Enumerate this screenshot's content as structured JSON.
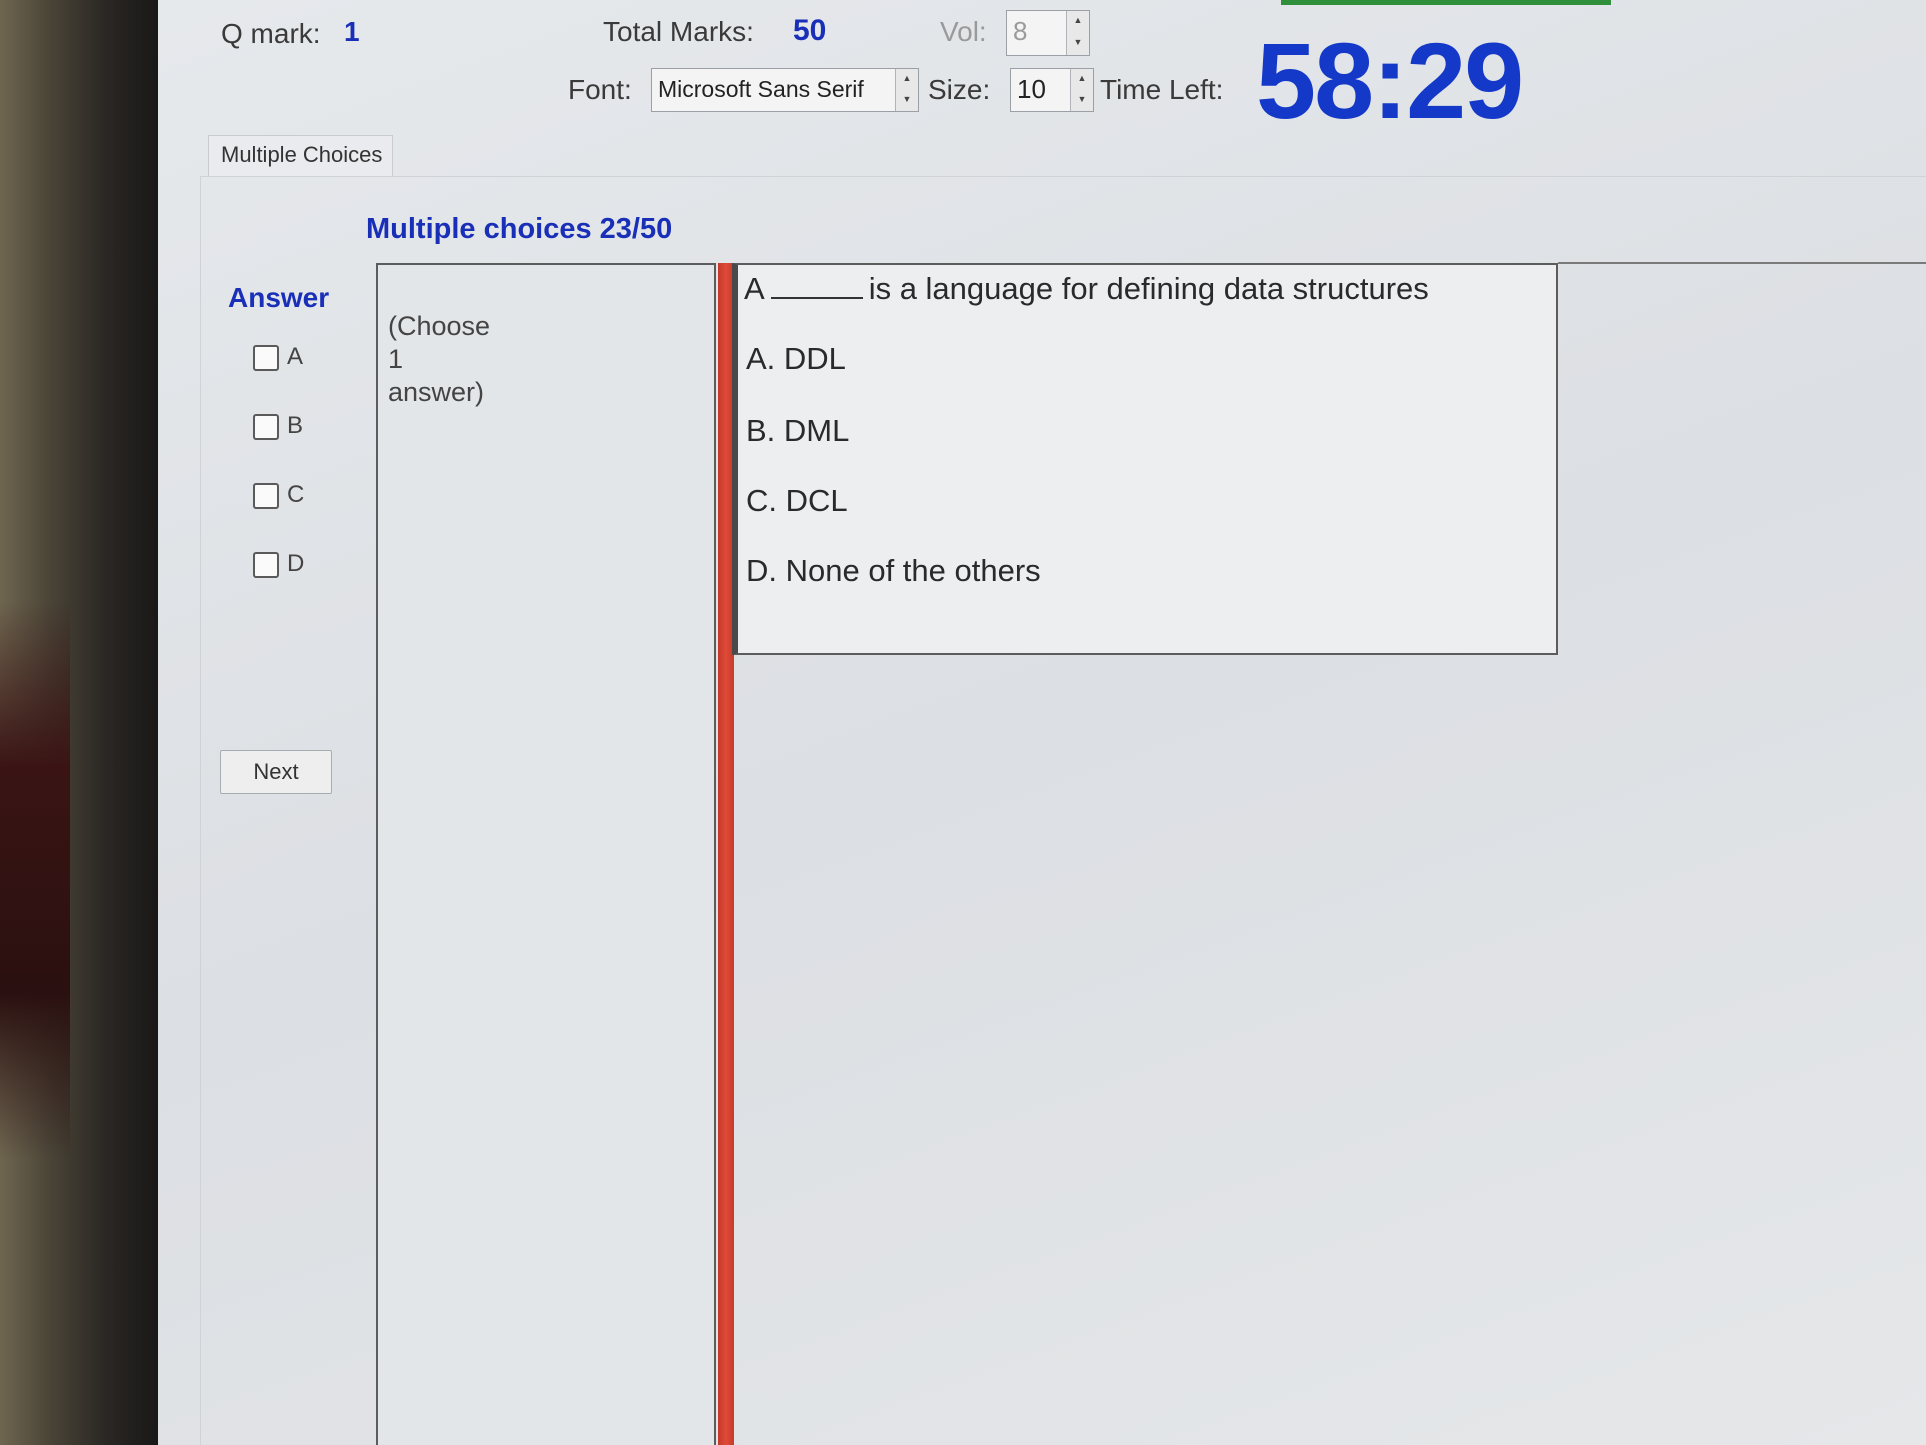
{
  "header": {
    "q_mark_label": "Q mark:",
    "q_mark_value": "1",
    "total_marks_label": "Total Marks:",
    "total_marks_value": "50",
    "vol_label": "Vol:",
    "vol_value": "8",
    "font_label": "Font:",
    "font_value": "Microsoft Sans Serif",
    "size_label": "Size:",
    "size_value": "10",
    "time_left_label": "Time Left:",
    "time_left_value": "58:29"
  },
  "tab": {
    "label": "Multiple Choices"
  },
  "section": {
    "title": "Multiple choices 23/50"
  },
  "answer": {
    "title": "Answer",
    "options": [
      "A",
      "B",
      "C",
      "D"
    ],
    "next_label": "Next"
  },
  "instruction": "(Choose\n1\nanswer)",
  "question": {
    "prefix": "A",
    "suffix": "is a  language for defining data structures",
    "choices": [
      "A.  DDL",
      "B.  DML",
      "C.  DCL",
      "D.  None of the others"
    ]
  },
  "colors": {
    "accent_blue": "#1a2fb8",
    "timer_blue": "#1438c8",
    "divider_red": "#e04a36",
    "progress_green": "#2f8f3a"
  },
  "icons": [
    "spin-up-icon",
    "spin-down-icon",
    "checkbox-icon"
  ]
}
